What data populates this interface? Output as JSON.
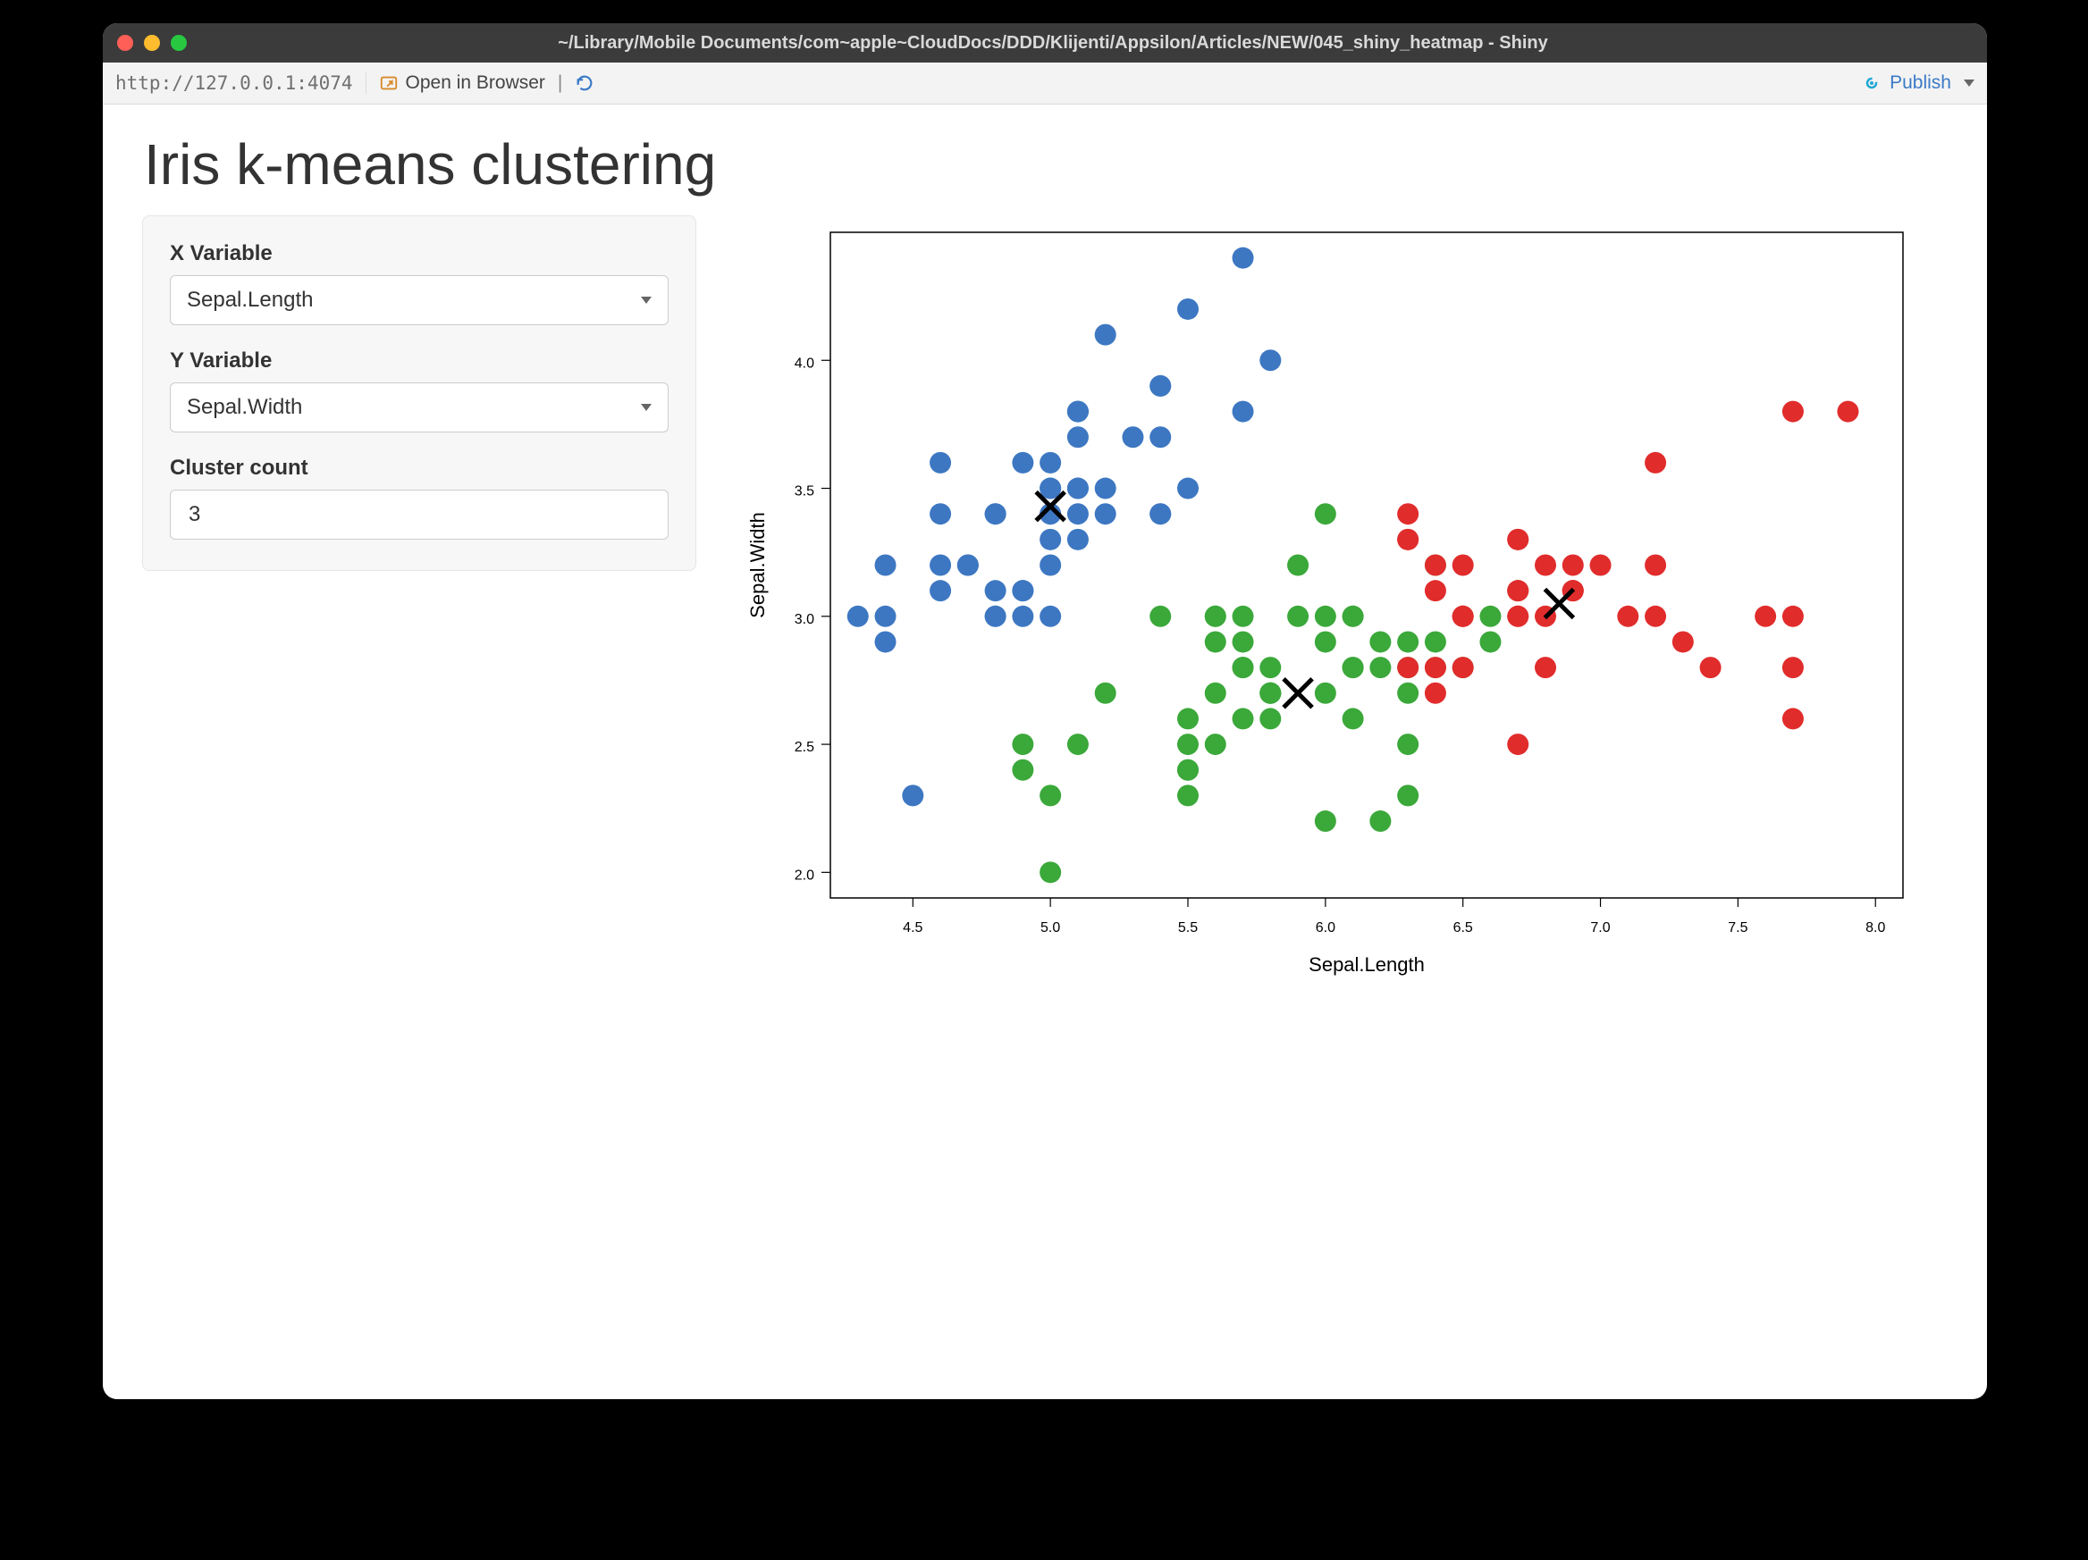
{
  "window": {
    "title": "~/Library/Mobile Documents/com~apple~CloudDocs/DDD/Klijenti/Appsilon/Articles/NEW/045_shiny_heatmap - Shiny"
  },
  "toolbar": {
    "url": "http://127.0.0.1:4074",
    "open_in_browser_label": "Open in Browser",
    "publish_label": "Publish"
  },
  "page": {
    "title": "Iris k-means clustering"
  },
  "sidebar": {
    "xvar": {
      "label": "X Variable",
      "value": "Sepal.Length"
    },
    "yvar": {
      "label": "Y Variable",
      "value": "Sepal.Width"
    },
    "clusters": {
      "label": "Cluster count",
      "value": "3"
    }
  },
  "chart_data": {
    "type": "scatter",
    "xlabel": "Sepal.Length",
    "ylabel": "Sepal.Width",
    "xlim": [
      4.2,
      8.1
    ],
    "ylim": [
      1.9,
      4.5
    ],
    "xticks": [
      4.5,
      5.0,
      5.5,
      6.0,
      6.5,
      7.0,
      7.5,
      8.0
    ],
    "yticks": [
      2.0,
      2.5,
      3.0,
      3.5,
      4.0
    ],
    "colors": {
      "1": "#3d77c2",
      "2": "#3ba83a",
      "3": "#e12c2c"
    },
    "centroids": [
      {
        "x": 5.0,
        "y": 3.43
      },
      {
        "x": 5.9,
        "y": 2.7
      },
      {
        "x": 6.85,
        "y": 3.05
      }
    ],
    "series": [
      {
        "name": "Cluster 1",
        "cluster": 1,
        "points": [
          {
            "x": 5.1,
            "y": 3.5
          },
          {
            "x": 4.9,
            "y": 3.0
          },
          {
            "x": 4.7,
            "y": 3.2
          },
          {
            "x": 4.6,
            "y": 3.1
          },
          {
            "x": 5.0,
            "y": 3.6
          },
          {
            "x": 5.4,
            "y": 3.9
          },
          {
            "x": 4.6,
            "y": 3.4
          },
          {
            "x": 5.0,
            "y": 3.4
          },
          {
            "x": 4.4,
            "y": 2.9
          },
          {
            "x": 4.9,
            "y": 3.1
          },
          {
            "x": 5.4,
            "y": 3.7
          },
          {
            "x": 4.8,
            "y": 3.4
          },
          {
            "x": 4.8,
            "y": 3.0
          },
          {
            "x": 4.3,
            "y": 3.0
          },
          {
            "x": 5.8,
            "y": 4.0
          },
          {
            "x": 5.7,
            "y": 4.4
          },
          {
            "x": 5.4,
            "y": 3.9
          },
          {
            "x": 5.1,
            "y": 3.5
          },
          {
            "x": 5.7,
            "y": 3.8
          },
          {
            "x": 5.1,
            "y": 3.8
          },
          {
            "x": 5.4,
            "y": 3.4
          },
          {
            "x": 5.1,
            "y": 3.7
          },
          {
            "x": 4.6,
            "y": 3.6
          },
          {
            "x": 5.1,
            "y": 3.3
          },
          {
            "x": 4.8,
            "y": 3.4
          },
          {
            "x": 5.0,
            "y": 3.0
          },
          {
            "x": 5.0,
            "y": 3.4
          },
          {
            "x": 5.2,
            "y": 3.5
          },
          {
            "x": 5.2,
            "y": 3.4
          },
          {
            "x": 4.7,
            "y": 3.2
          },
          {
            "x": 4.8,
            "y": 3.1
          },
          {
            "x": 5.4,
            "y": 3.4
          },
          {
            "x": 5.2,
            "y": 4.1
          },
          {
            "x": 5.5,
            "y": 4.2
          },
          {
            "x": 4.9,
            "y": 3.1
          },
          {
            "x": 5.0,
            "y": 3.2
          },
          {
            "x": 5.5,
            "y": 3.5
          },
          {
            "x": 4.9,
            "y": 3.6
          },
          {
            "x": 4.4,
            "y": 3.0
          },
          {
            "x": 5.1,
            "y": 3.4
          },
          {
            "x": 5.0,
            "y": 3.5
          },
          {
            "x": 4.5,
            "y": 2.3
          },
          {
            "x": 4.4,
            "y": 3.2
          },
          {
            "x": 5.0,
            "y": 3.5
          },
          {
            "x": 5.1,
            "y": 3.8
          },
          {
            "x": 4.8,
            "y": 3.0
          },
          {
            "x": 5.1,
            "y": 3.8
          },
          {
            "x": 4.6,
            "y": 3.2
          },
          {
            "x": 5.3,
            "y": 3.7
          },
          {
            "x": 5.0,
            "y": 3.3
          }
        ]
      },
      {
        "name": "Cluster 2",
        "cluster": 2,
        "points": [
          {
            "x": 5.5,
            "y": 2.3
          },
          {
            "x": 5.7,
            "y": 2.8
          },
          {
            "x": 4.9,
            "y": 2.4
          },
          {
            "x": 5.2,
            "y": 2.7
          },
          {
            "x": 5.0,
            "y": 2.0
          },
          {
            "x": 6.0,
            "y": 2.2
          },
          {
            "x": 5.6,
            "y": 2.9
          },
          {
            "x": 5.8,
            "y": 2.7
          },
          {
            "x": 6.2,
            "y": 2.2
          },
          {
            "x": 5.6,
            "y": 2.5
          },
          {
            "x": 5.9,
            "y": 3.2
          },
          {
            "x": 6.1,
            "y": 2.8
          },
          {
            "x": 6.3,
            "y": 2.5
          },
          {
            "x": 6.1,
            "y": 2.8
          },
          {
            "x": 6.4,
            "y": 2.9
          },
          {
            "x": 6.6,
            "y": 3.0
          },
          {
            "x": 5.6,
            "y": 3.0
          },
          {
            "x": 6.7,
            "y": 3.1
          },
          {
            "x": 6.0,
            "y": 2.9
          },
          {
            "x": 5.7,
            "y": 2.6
          },
          {
            "x": 5.5,
            "y": 2.4
          },
          {
            "x": 5.5,
            "y": 2.4
          },
          {
            "x": 5.8,
            "y": 2.7
          },
          {
            "x": 6.0,
            "y": 2.7
          },
          {
            "x": 5.4,
            "y": 3.0
          },
          {
            "x": 6.0,
            "y": 3.4
          },
          {
            "x": 6.3,
            "y": 2.3
          },
          {
            "x": 5.6,
            "y": 3.0
          },
          {
            "x": 5.5,
            "y": 2.5
          },
          {
            "x": 5.5,
            "y": 2.6
          },
          {
            "x": 6.1,
            "y": 3.0
          },
          {
            "x": 5.8,
            "y": 2.6
          },
          {
            "x": 5.0,
            "y": 2.3
          },
          {
            "x": 5.6,
            "y": 2.7
          },
          {
            "x": 5.7,
            "y": 3.0
          },
          {
            "x": 5.7,
            "y": 2.9
          },
          {
            "x": 6.2,
            "y": 2.9
          },
          {
            "x": 5.1,
            "y": 2.5
          },
          {
            "x": 5.7,
            "y": 2.8
          },
          {
            "x": 5.8,
            "y": 2.7
          },
          {
            "x": 4.9,
            "y": 2.5
          },
          {
            "x": 5.8,
            "y": 2.8
          },
          {
            "x": 6.1,
            "y": 2.6
          },
          {
            "x": 6.3,
            "y": 2.7
          },
          {
            "x": 6.2,
            "y": 2.8
          },
          {
            "x": 6.1,
            "y": 3.0
          },
          {
            "x": 6.3,
            "y": 2.8
          },
          {
            "x": 6.0,
            "y": 3.0
          },
          {
            "x": 5.8,
            "y": 2.7
          },
          {
            "x": 6.3,
            "y": 2.9
          },
          {
            "x": 5.9,
            "y": 3.0
          },
          {
            "x": 6.5,
            "y": 2.8
          },
          {
            "x": 6.4,
            "y": 2.8
          },
          {
            "x": 6.4,
            "y": 3.2
          },
          {
            "x": 6.6,
            "y": 2.9
          }
        ]
      },
      {
        "name": "Cluster 3",
        "cluster": 3,
        "points": [
          {
            "x": 7.0,
            "y": 3.2
          },
          {
            "x": 6.9,
            "y": 3.1
          },
          {
            "x": 6.5,
            "y": 2.8
          },
          {
            "x": 6.3,
            "y": 3.3
          },
          {
            "x": 6.8,
            "y": 2.8
          },
          {
            "x": 6.7,
            "y": 3.0
          },
          {
            "x": 6.7,
            "y": 3.1
          },
          {
            "x": 6.3,
            "y": 3.3
          },
          {
            "x": 7.1,
            "y": 3.0
          },
          {
            "x": 6.5,
            "y": 3.0
          },
          {
            "x": 7.6,
            "y": 3.0
          },
          {
            "x": 7.3,
            "y": 2.9
          },
          {
            "x": 6.7,
            "y": 2.5
          },
          {
            "x": 7.2,
            "y": 3.6
          },
          {
            "x": 6.4,
            "y": 2.7
          },
          {
            "x": 6.8,
            "y": 3.0
          },
          {
            "x": 6.4,
            "y": 3.2
          },
          {
            "x": 6.5,
            "y": 3.0
          },
          {
            "x": 7.7,
            "y": 3.8
          },
          {
            "x": 7.7,
            "y": 2.6
          },
          {
            "x": 6.9,
            "y": 3.2
          },
          {
            "x": 7.7,
            "y": 2.8
          },
          {
            "x": 6.7,
            "y": 3.3
          },
          {
            "x": 7.2,
            "y": 3.2
          },
          {
            "x": 6.4,
            "y": 2.8
          },
          {
            "x": 7.2,
            "y": 3.0
          },
          {
            "x": 7.4,
            "y": 2.8
          },
          {
            "x": 7.9,
            "y": 3.8
          },
          {
            "x": 6.3,
            "y": 2.8
          },
          {
            "x": 7.7,
            "y": 3.0
          },
          {
            "x": 6.9,
            "y": 3.1
          },
          {
            "x": 6.7,
            "y": 3.1
          },
          {
            "x": 6.9,
            "y": 3.1
          },
          {
            "x": 6.8,
            "y": 3.2
          },
          {
            "x": 6.7,
            "y": 3.3
          },
          {
            "x": 6.7,
            "y": 3.0
          },
          {
            "x": 6.5,
            "y": 3.0
          },
          {
            "x": 6.5,
            "y": 3.2
          },
          {
            "x": 6.4,
            "y": 3.1
          },
          {
            "x": 6.3,
            "y": 3.4
          }
        ]
      }
    ]
  }
}
